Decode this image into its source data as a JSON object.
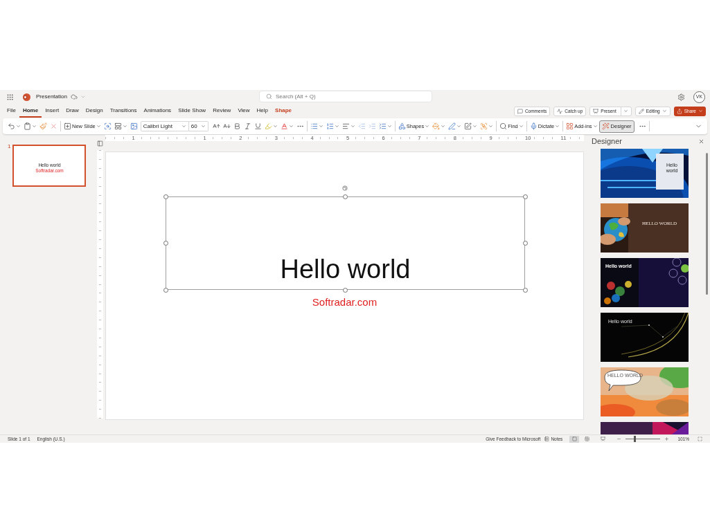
{
  "app_bar": {
    "title": "Presentation",
    "search": {
      "placeholder": "Search (Alt + Q)"
    },
    "avatar": "VK"
  },
  "ribbon_tabs": [
    {
      "label": "File",
      "selected": false,
      "kind": "normal"
    },
    {
      "label": "Home",
      "selected": true,
      "kind": "normal"
    },
    {
      "label": "Insert",
      "selected": false,
      "kind": "normal"
    },
    {
      "label": "Draw",
      "selected": false,
      "kind": "normal"
    },
    {
      "label": "Design",
      "selected": false,
      "kind": "normal"
    },
    {
      "label": "Transitions",
      "selected": false,
      "kind": "normal"
    },
    {
      "label": "Animations",
      "selected": false,
      "kind": "normal"
    },
    {
      "label": "Slide Show",
      "selected": false,
      "kind": "normal"
    },
    {
      "label": "Review",
      "selected": false,
      "kind": "normal"
    },
    {
      "label": "View",
      "selected": false,
      "kind": "normal"
    },
    {
      "label": "Help",
      "selected": false,
      "kind": "normal"
    },
    {
      "label": "Shape",
      "selected": false,
      "kind": "contextual"
    }
  ],
  "ribbon_actions": [
    {
      "label": "Comments",
      "kind": "comments"
    },
    {
      "label": "Catch up",
      "kind": "catchup"
    },
    {
      "label": "Present",
      "kind": "present"
    },
    {
      "label": "Editing",
      "kind": "editing"
    },
    {
      "label": "Share",
      "kind": "share"
    }
  ],
  "toolbar": {
    "new_slide": "New Slide",
    "font": "Calibri Light",
    "font_size": "60",
    "shapes": "Shapes",
    "find": "Find",
    "dictate": "Dictate",
    "add_ins": "Add-ins",
    "designer": {
      "label": "Designer",
      "selected": true
    }
  },
  "ruler": {
    "labels": [
      "1",
      "1",
      "2",
      "3",
      "4",
      "5",
      "6",
      "7",
      "8",
      "9",
      "10",
      "11"
    ]
  },
  "slides": [
    {
      "number": "1",
      "selected": true,
      "title": "Hello world",
      "subtitle": "Softradar.com"
    }
  ],
  "slide": {
    "title": "Hello world",
    "subtitle": "Softradar.com"
  },
  "designer": {
    "title": "Designer",
    "designs": [
      {
        "kind": "space",
        "title": "Hello world"
      },
      {
        "kind": "globe",
        "title": "HELLO WORLD"
      },
      {
        "kind": "bokeh",
        "title": "Hello world"
      },
      {
        "kind": "network",
        "title": "Hello world"
      },
      {
        "kind": "watercolor",
        "title": "HELLO WORLD"
      },
      {
        "kind": "purple"
      }
    ]
  },
  "status_bar": {
    "slide_count": "Slide 1 of 1",
    "language": "English (U.S.)",
    "feedback": "Give Feedback to Microsoft",
    "notes": "Notes",
    "zoom": "101%",
    "zoom_slider": {
      "level": 0.25
    }
  }
}
